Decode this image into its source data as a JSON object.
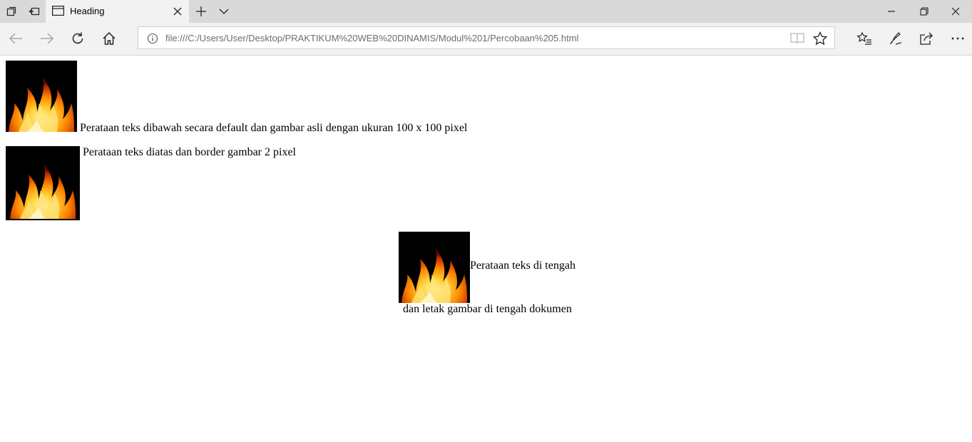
{
  "browser": {
    "tab": {
      "title": "Heading"
    },
    "address": {
      "url": "file:///C:/Users/User/Desktop/PRAKTIKUM%20WEB%20DINAMIS/Modul%201/Percobaan%205.html"
    }
  },
  "page": {
    "line1": "Perataan teks dibawah secara default dan gambar asli dengan ukuran 100 x 100 pixel",
    "line2": "Perataan teks diatas dan border gambar 2 pixel",
    "line3": "Perataan teks di tengah",
    "line4": "dan letak gambar di tengah dokumen"
  },
  "colors": {
    "titlebar": "#d9d9d9",
    "toolbar": "#f2f2f2",
    "url_text": "#6d6d6d",
    "fire_orange": "#ff8a00",
    "fire_yellow": "#ffd23a",
    "fire_bg": "#000000"
  }
}
